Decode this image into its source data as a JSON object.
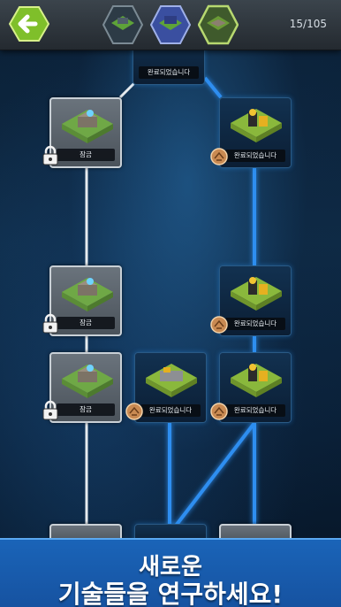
{
  "top_bar": {
    "progress": "15/105",
    "tabs": [
      {
        "icon": "military-building-icon",
        "state": "inactive"
      },
      {
        "icon": "factory-building-icon",
        "state": "inactive"
      },
      {
        "icon": "road-tile-icon",
        "state": "active"
      }
    ]
  },
  "nodes": {
    "top_label": "완료되었습니다",
    "r1_left": "잠금",
    "r1_right": "완료되었습니다",
    "r2_left": "잠금",
    "r2_right": "완료되었습니다",
    "r3_left": "잠금",
    "r3_mid": "완료되었습니다",
    "r3_right": "완료되었습니다"
  },
  "banner": {
    "line1": "새로운",
    "line2": "기술들을 연구하세요!"
  },
  "colors": {
    "link_locked": "#e6ebef",
    "link_done": "#2f8ef0",
    "banner": "#1a64b8"
  }
}
